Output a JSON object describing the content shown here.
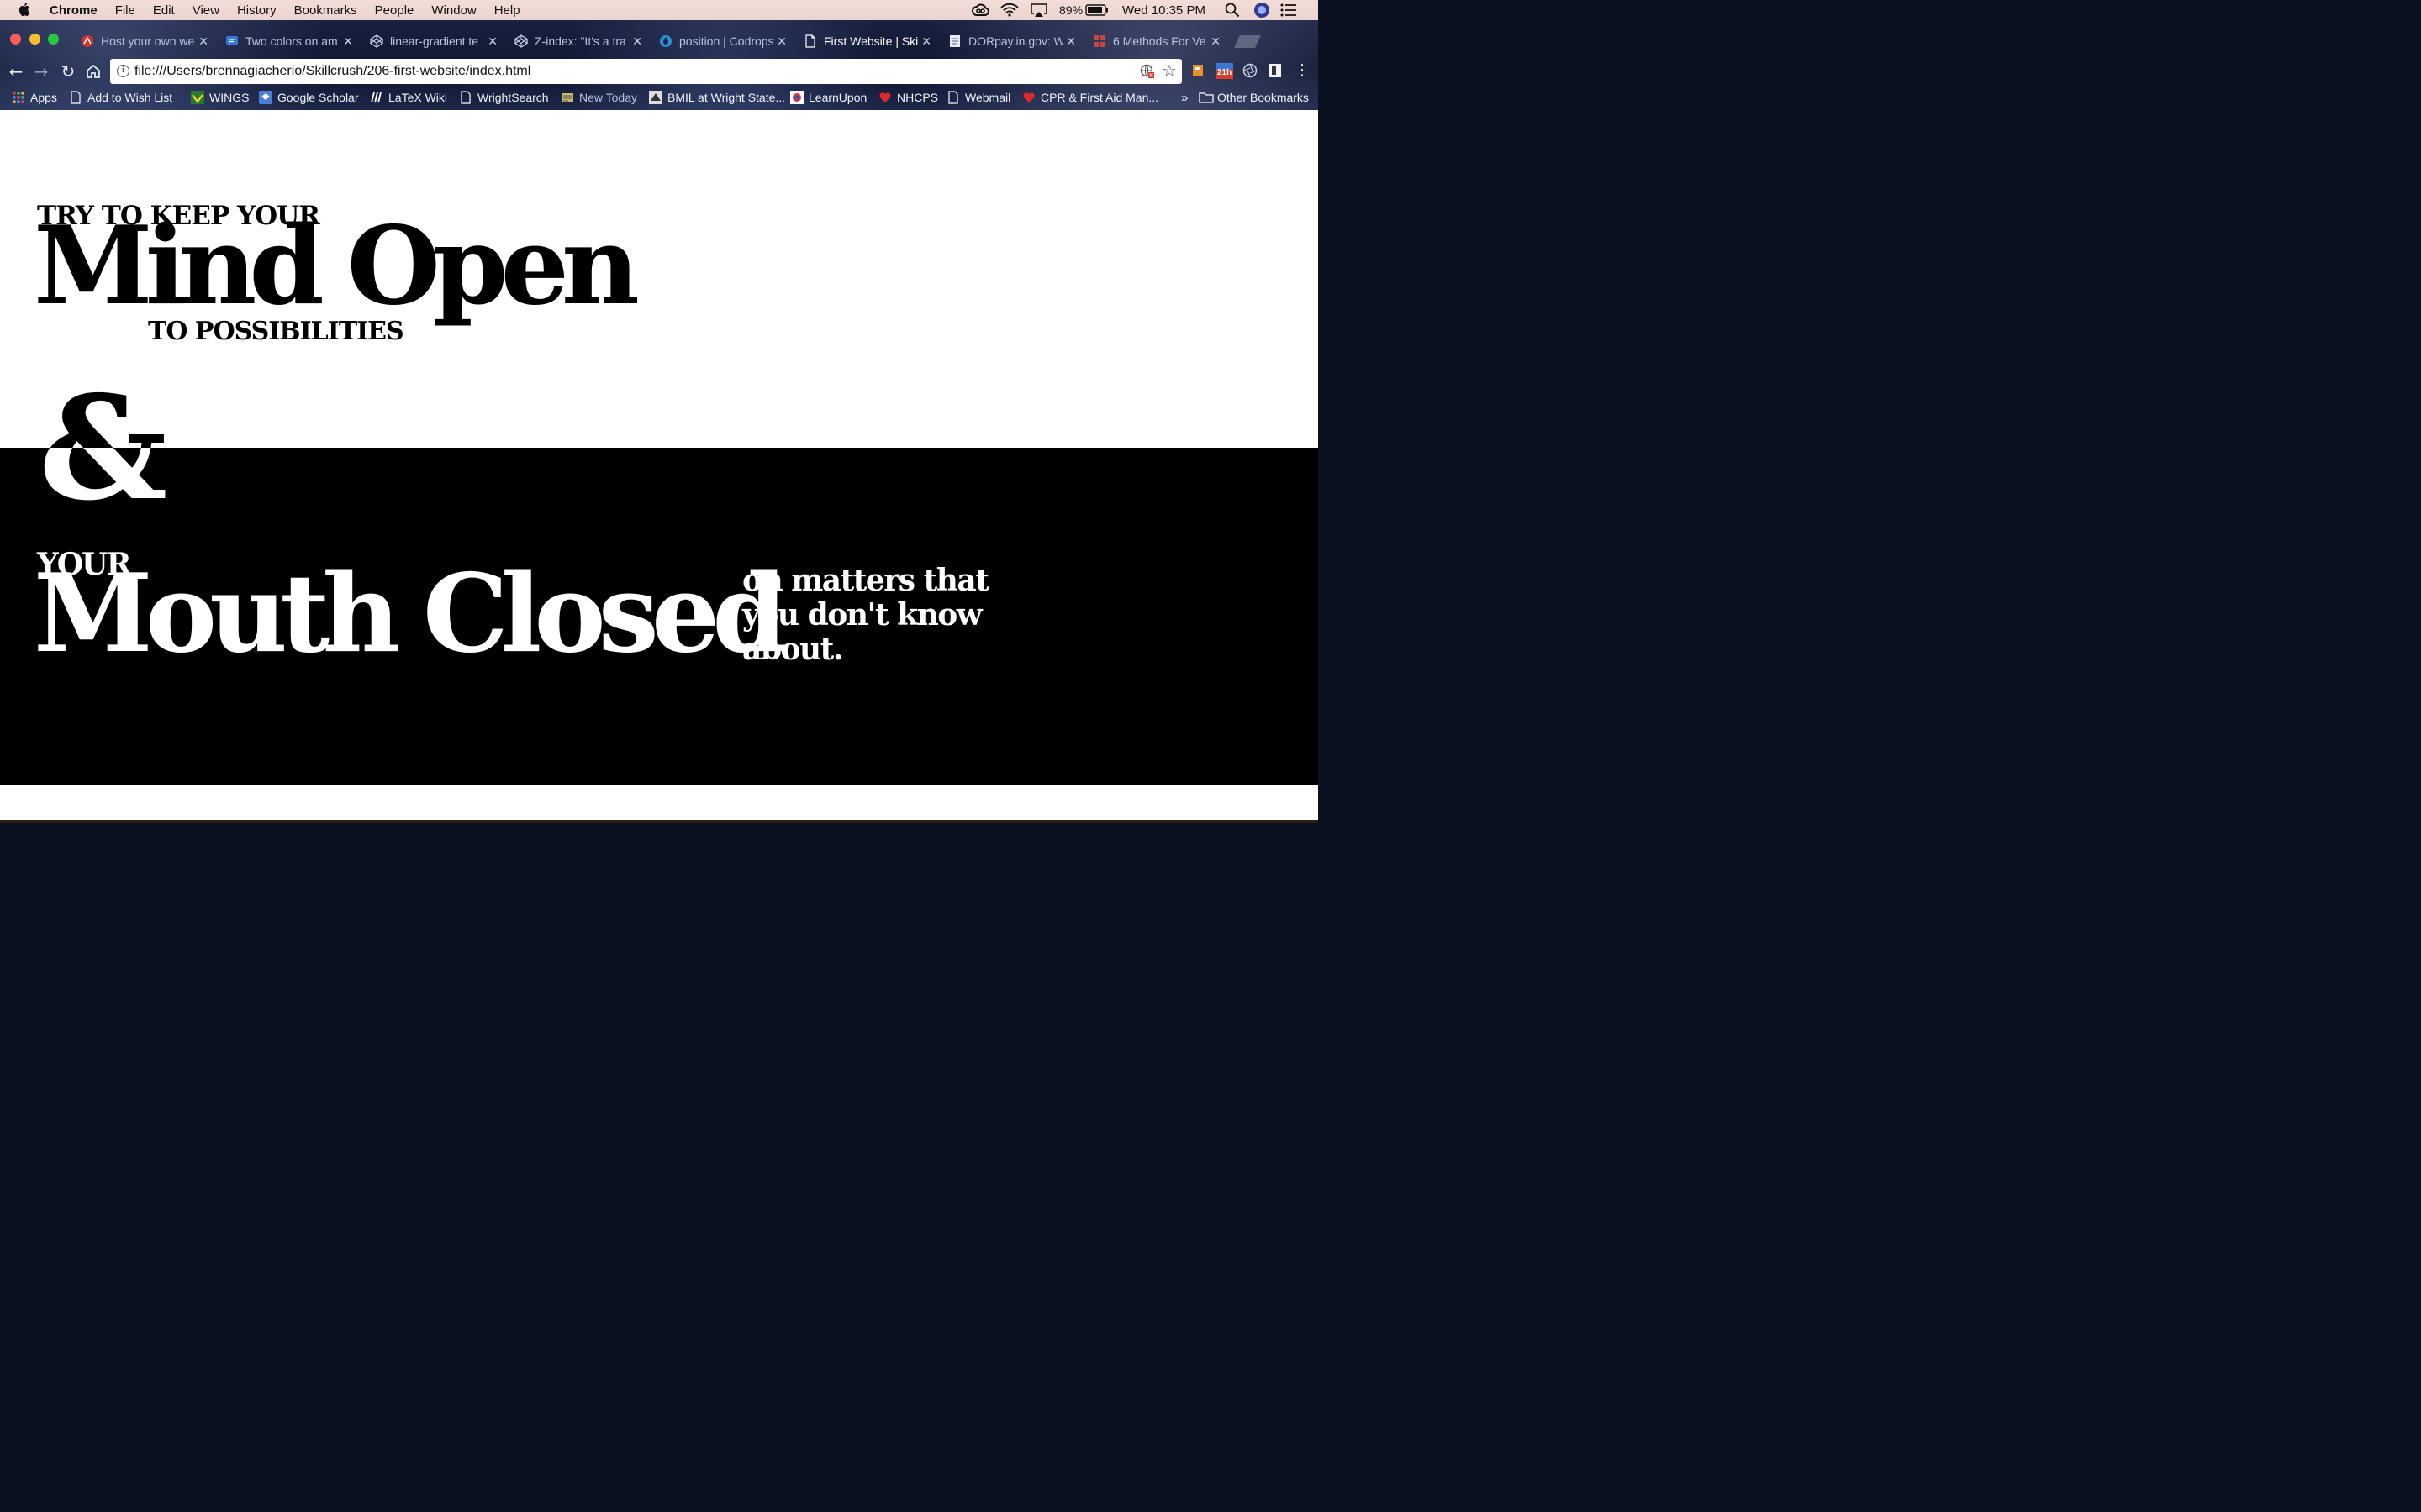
{
  "menubar": {
    "app_name": "Chrome",
    "menus": [
      "File",
      "Edit",
      "View",
      "History",
      "Bookmarks",
      "People",
      "Window",
      "Help"
    ],
    "battery_percent": "89%",
    "clock": "Wed 10:35 PM"
  },
  "tabs": [
    {
      "title": "Host your own we",
      "icon": "red-logo-icon",
      "active": false
    },
    {
      "title": "Two colors on am",
      "icon": "blue-chat-icon",
      "active": false
    },
    {
      "title": "linear-gradient te",
      "icon": "codepen-icon",
      "active": false
    },
    {
      "title": "Z-index: \"It's a tra",
      "icon": "codepen-icon",
      "active": false
    },
    {
      "title": "position | Codrops",
      "icon": "codrops-drop-icon",
      "active": false
    },
    {
      "title": "First Website | Ski",
      "icon": "page-icon",
      "active": true
    },
    {
      "title": "DORpay.in.gov: W",
      "icon": "doc-icon",
      "active": false
    },
    {
      "title": "6 Methods For Ve",
      "icon": "grid-icon",
      "active": false
    }
  ],
  "address_bar": {
    "url": "file:///Users/brennagiacherio/Skillcrush/206-first-website/index.html"
  },
  "extension_badge": "21h",
  "bookmarks": [
    {
      "label": "Apps",
      "icon": "apps-grid-icon"
    },
    {
      "label": "Add to Wish List",
      "icon": "page-icon"
    },
    {
      "label": "WINGS",
      "icon": "wings-icon"
    },
    {
      "label": "Google Scholar",
      "icon": "scholar-icon"
    },
    {
      "label": "LaTeX Wiki",
      "icon": "latex-icon"
    },
    {
      "label": "WrightSearch",
      "icon": "page-icon"
    },
    {
      "label": "New Today",
      "icon": "news-icon"
    },
    {
      "label": "BMIL at Wright State...",
      "icon": "bmil-icon"
    },
    {
      "label": "LearnUpon",
      "icon": "learnupon-icon"
    },
    {
      "label": "NHCPS",
      "icon": "heart-icon"
    },
    {
      "label": "Webmail",
      "icon": "page-icon"
    },
    {
      "label": "CPR & First Aid Man...",
      "icon": "heart-icon"
    }
  ],
  "bookmarks_overflow": "»",
  "other_bookmarks": "Other Bookmarks",
  "page": {
    "line1": "TRY TO KEEP YOUR",
    "line2": "Mind Open",
    "line3": "TO POSSIBILITIES",
    "ampersand": "&",
    "line4": "YOUR",
    "line5": "Mouth Closed",
    "line6": "on matters that you don't know about."
  },
  "colors": {
    "page_background": "#ffffff",
    "band_background": "#000000",
    "text_dark": "#000000",
    "text_light": "#ffffff"
  }
}
